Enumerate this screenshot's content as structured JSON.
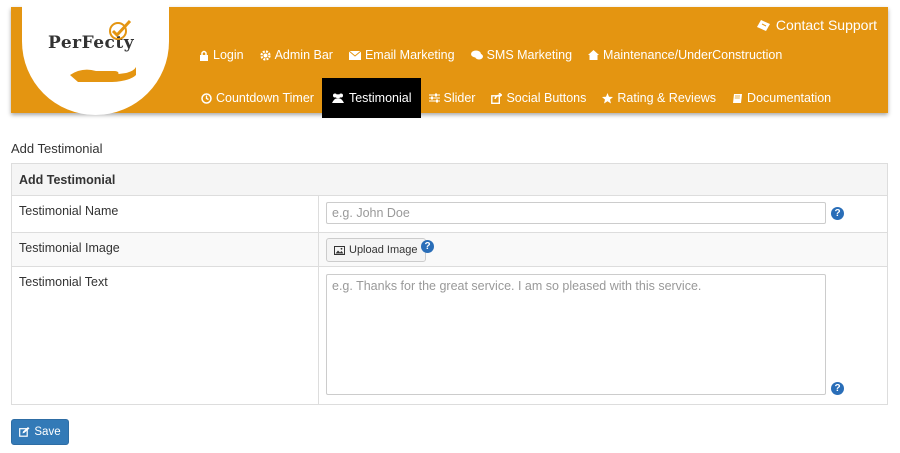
{
  "header": {
    "logo_text": "PerFecty",
    "contact_support": "Contact Support",
    "nav_row1": [
      {
        "label": "Login",
        "icon": "lock-icon"
      },
      {
        "label": "Admin Bar",
        "icon": "gear-icon"
      },
      {
        "label": "Email Marketing",
        "icon": "envelope-icon"
      },
      {
        "label": "SMS Marketing",
        "icon": "chat-bubbles-icon"
      },
      {
        "label": "Maintenance/UnderConstruction",
        "icon": "home-icon"
      }
    ],
    "nav_row2": [
      {
        "label": "Countdown Timer",
        "icon": "clock-icon"
      },
      {
        "label": "Testimonial",
        "icon": "users-icon",
        "active": true
      },
      {
        "label": "Slider",
        "icon": "sliders-icon"
      },
      {
        "label": "Social Buttons",
        "icon": "share-icon"
      },
      {
        "label": "Rating & Reviews",
        "icon": "star-icon"
      },
      {
        "label": "Documentation",
        "icon": "book-icon"
      }
    ],
    "colors": {
      "bar": "#e49511",
      "active": "#000000"
    }
  },
  "page": {
    "heading": "Add Testimonial"
  },
  "form": {
    "panel_title": "Add Testimonial",
    "name_label": "Testimonial Name",
    "name_placeholder": "e.g. John Doe",
    "name_value": "",
    "image_label": "Testimonial Image",
    "upload_label": "Upload Image",
    "text_label": "Testimonial Text",
    "text_placeholder": "e.g. Thanks for the great service. I am so pleased with this service.",
    "text_value": "",
    "help_symbol": "?"
  },
  "actions": {
    "save_label": "Save",
    "save_color": "#337ab7"
  }
}
